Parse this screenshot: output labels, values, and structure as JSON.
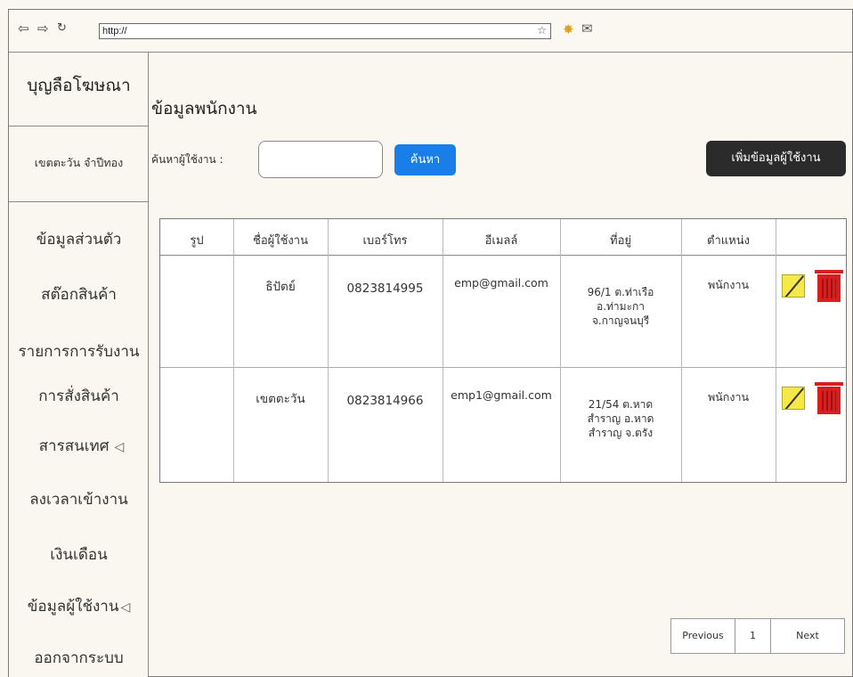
{
  "browser": {
    "url": "http://"
  },
  "sidebar": {
    "brand": "บุญลือโฆษณา",
    "username": "เขตตะวัน จำปีทอง",
    "items": [
      {
        "label": "ข้อมูลส่วนตัว"
      },
      {
        "label": "สต๊อกสินค้า"
      },
      {
        "label": "รายการการรับงาน"
      },
      {
        "label": "การสั่งสินค้า"
      },
      {
        "label": "สารสนเทศ"
      },
      {
        "label": "ลงเวลาเข้างาน"
      },
      {
        "label": "เงินเดือน"
      },
      {
        "label": "ข้อมูลผู้ใช้งาน"
      },
      {
        "label": "ออกจากระบบ"
      }
    ]
  },
  "main": {
    "title": "ข้อมูลพนักงาน",
    "search_label": "ค้นหาผู้ใช้งาน :",
    "search_value": "",
    "search_button": "ค้นหา",
    "add_button": "เพิ่มข้อมูลผู้ใช้งาน"
  },
  "table": {
    "headers": [
      "รูป",
      "ชื่อผู้ใช้งาน",
      "เบอร์โทร",
      "อีเมลล์",
      "ที่อยู่",
      "ตำแหน่ง",
      ""
    ],
    "rows": [
      {
        "name": "ธิปัตย์",
        "phone": "0823814995",
        "email": "emp@gmail.com",
        "address": [
          "96/1 ต.ท่าเรือ",
          "อ.ท่ามะกา",
          "จ.กาญจนบุรี"
        ],
        "position": "พนักงาน"
      },
      {
        "name": "เขตตะวัน",
        "phone": "0823814966",
        "email": "emp1@gmail.com",
        "address": [
          "21/54 ต.หาด",
          "สำราญ อ.หาด",
          "สำราญ จ.ตรัง"
        ],
        "position": "พนักงาน"
      }
    ]
  },
  "pagination": {
    "previous": "Previous",
    "page": "1",
    "next": "Next"
  }
}
